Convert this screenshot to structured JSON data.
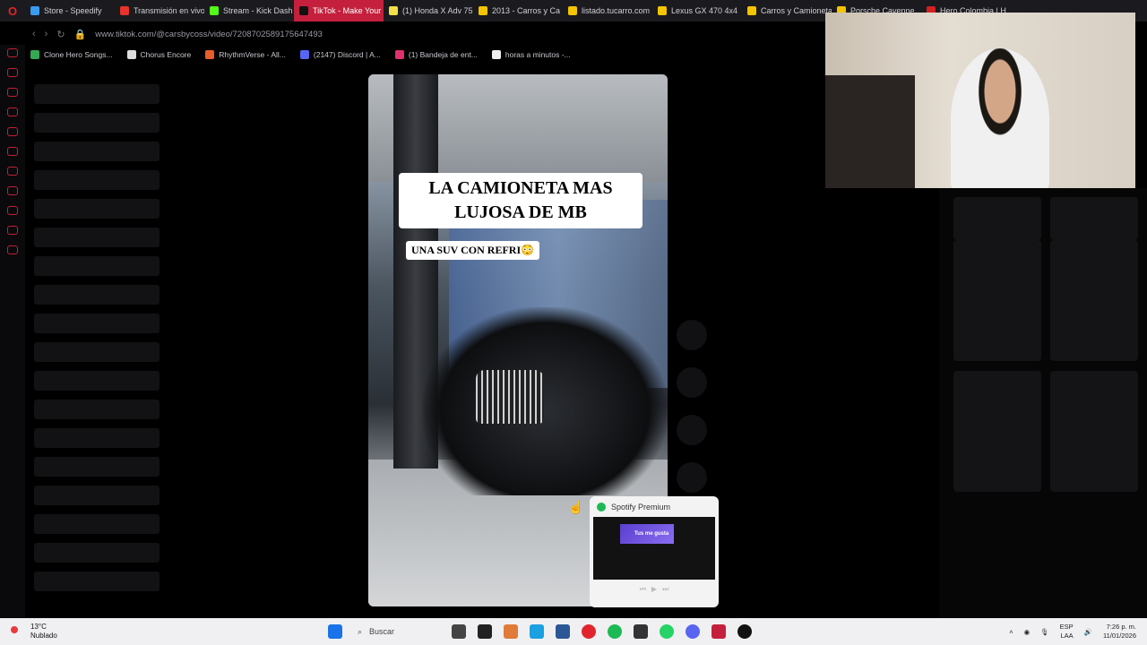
{
  "browser": {
    "tabs": [
      {
        "label": "Store - Speedify",
        "color": "#3a9bf0",
        "active": false
      },
      {
        "label": "Transmisión en vivo",
        "color": "#e8322b",
        "active": false
      },
      {
        "label": "Stream - Kick Dash",
        "color": "#53fc18",
        "active": false
      },
      {
        "label": "TikTok - Make Your Day",
        "color": "#111111",
        "active": true
      },
      {
        "label": "(1) Honda X Adv 75",
        "color": "#f1e04a",
        "active": false
      },
      {
        "label": "2013 - Carros y Ca",
        "color": "#f4c400",
        "active": false
      },
      {
        "label": "listado.tucarro.com",
        "color": "#f4c400",
        "active": false
      },
      {
        "label": "Lexus GX 470 4x4",
        "color": "#f4c400",
        "active": false
      },
      {
        "label": "Carros y Camionetas",
        "color": "#f4c400",
        "active": false
      },
      {
        "label": "Porsche Cayenne",
        "color": "#f4c400",
        "active": false
      },
      {
        "label": "Hero Colombia | H",
        "color": "#d62020",
        "active": false
      }
    ],
    "url": "www.tiktok.com/@carsbycoss/video/7208702589175647493",
    "bookmarks": [
      {
        "label": "Clone Hero Songs...",
        "color": "#34a853"
      },
      {
        "label": "Chorus Encore",
        "color": "#dddddd"
      },
      {
        "label": "RhythmVerse - All...",
        "color": "#e85d2b"
      },
      {
        "label": "(2147) Discord | A...",
        "color": "#5865f2"
      },
      {
        "label": "(1) Bandeja de ent...",
        "color": "#e1306c"
      },
      {
        "label": "horas a minutos -...",
        "color": "#eeeeee"
      }
    ]
  },
  "video": {
    "caption_title": "LA CAMIONETA MAS LUJOSA DE MB",
    "caption_sub": "UNA SUV CON REFRI😳"
  },
  "spotify_popup": {
    "title": "Spotify Premium",
    "preview_label": "Tus me gusta"
  },
  "taskbar": {
    "weather_temp": "13°C",
    "weather_desc": "Nublado",
    "search_label": "Buscar",
    "lang_line1": "ESP",
    "lang_line2": "LAA",
    "time": "7:26 p. m.",
    "date": "11/01/2026"
  }
}
